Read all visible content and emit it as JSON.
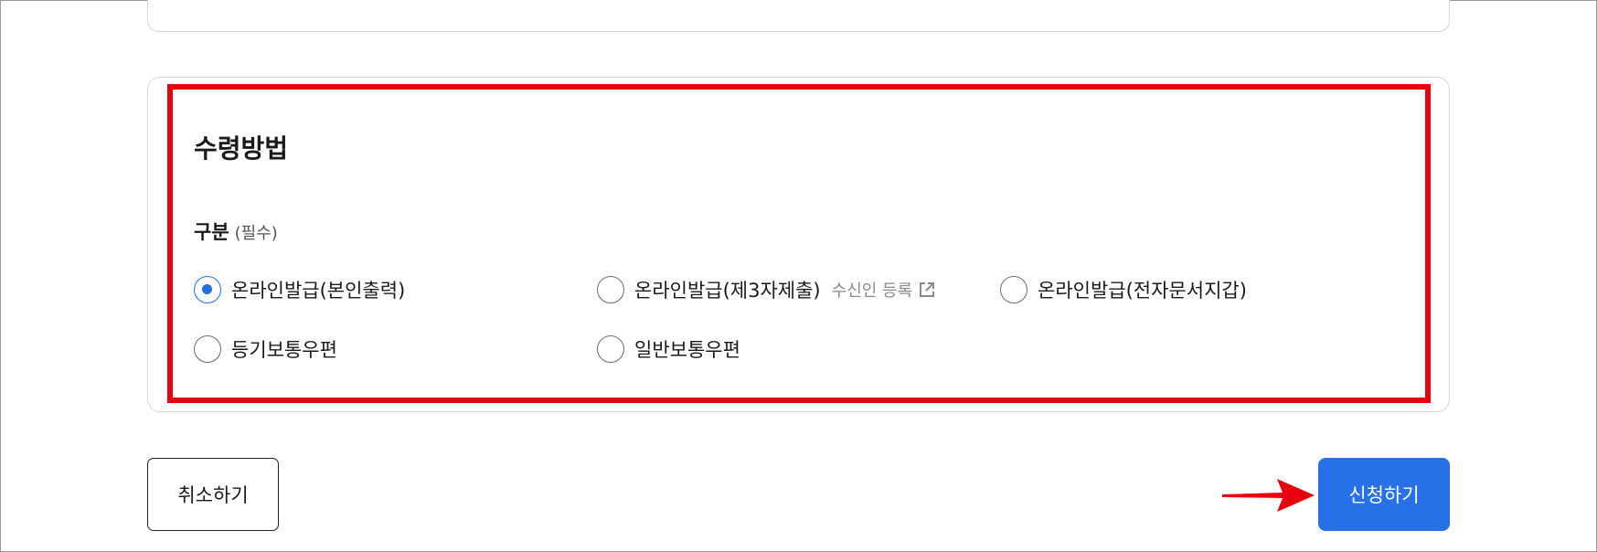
{
  "section": {
    "title": "수령방법",
    "field_label": "구분",
    "required_label": "(필수)"
  },
  "options": [
    {
      "label": "온라인발급(본인출력)",
      "checked": true
    },
    {
      "label": "온라인발급(제3자제출)",
      "checked": false,
      "link_label": "수신인 등록",
      "link_icon": "external-link-icon"
    },
    {
      "label": "온라인발급(전자문서지갑)",
      "checked": false
    },
    {
      "label": "등기보통우편",
      "checked": false
    },
    {
      "label": "일반보통우편",
      "checked": false
    }
  ],
  "buttons": {
    "cancel_label": "취소하기",
    "apply_label": "신청하기"
  },
  "colors": {
    "primary": "#2870e8",
    "highlight_border": "#e8000f",
    "radio_checked": "#1f6fe5"
  }
}
